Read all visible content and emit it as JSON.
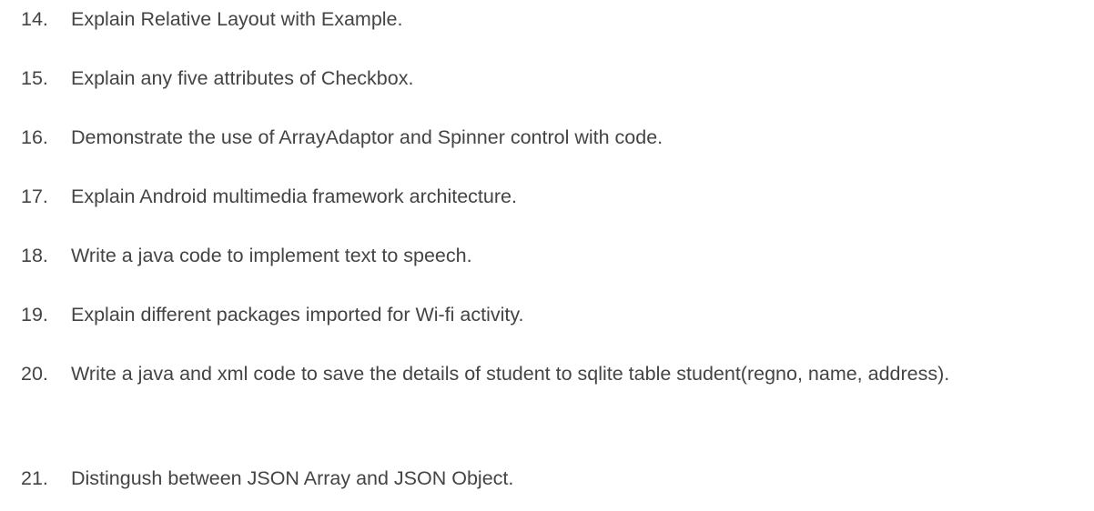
{
  "questions": [
    {
      "number": "14.",
      "text": "Explain Relative Layout with Example."
    },
    {
      "number": "15.",
      "text": "Explain any five attributes of Checkbox."
    },
    {
      "number": "16.",
      "text": "Demonstrate the use of ArrayAdaptor and Spinner control with code."
    },
    {
      "number": "17.",
      "text": "Explain Android multimedia framework architecture."
    },
    {
      "number": "18.",
      "text": "Write a java code to implement text to speech."
    },
    {
      "number": "19.",
      "text": "Explain different packages imported for Wi-fi activity."
    },
    {
      "number": "20.",
      "text": "Write a java and xml code to save the details of student to sqlite table student(regno, name, address)."
    },
    {
      "number": "21.",
      "text": "Distingush between JSON Array and JSON Object."
    }
  ]
}
